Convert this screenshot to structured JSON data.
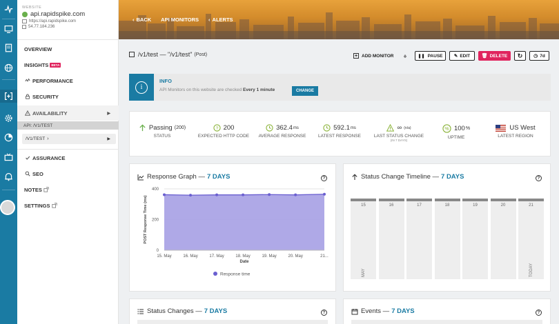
{
  "site": {
    "caption": "WEBSITE",
    "name": "api.rapidspike.com",
    "url": "https://api.rapidspike.com",
    "ip": "54.77.184.236"
  },
  "nav": {
    "overview": "OVERVIEW",
    "insights": "INSIGHTS",
    "beta": "BETA",
    "performance": "PERFORMANCE",
    "security": "SECURITY",
    "availability": "AVAILABILITY",
    "api_header": "API: /V1/TEST",
    "api_item": "/V1/TEST",
    "assurance": "ASSURANCE",
    "seo": "SEO",
    "notes": "NOTES",
    "settings": "SETTINGS"
  },
  "topnav": {
    "back": "BACK",
    "api_monitors": "API MONITORS",
    "alerts": "ALERTS"
  },
  "title": {
    "path": "/v1/test — \"/v1/test\"",
    "method": "(Post)"
  },
  "toolbar": {
    "add_monitor": "ADD MONITOR",
    "pause": "PAUSE",
    "edit": "EDIT",
    "delete": "DELETE",
    "range": "7d"
  },
  "info": {
    "title": "INFO",
    "text": "API Monitors on this website are checked",
    "interval": "Every 1 minute",
    "change": "CHANGE"
  },
  "stats": {
    "status_value": "Passing",
    "status_count": "(200)",
    "status_label": "STATUS",
    "http_value": "200",
    "http_label": "EXPECTED HTTP CODE",
    "avg_value": "362.4",
    "avg_unit": "ms",
    "avg_label": "AVERAGE RESPONSE",
    "latest_value": "592.1",
    "latest_unit": "ms",
    "latest_label": "LATEST RESPONSE",
    "change_value": "∞",
    "change_note": "(n/a)",
    "change_label": "LAST STATUS CHANGE",
    "change_sub": "(IN 7 DAYS)",
    "uptime_value": "100",
    "uptime_unit": "%",
    "uptime_label": "UPTIME",
    "region_value": "US West",
    "region_label": "LATEST REGION"
  },
  "response_card": {
    "title": "Response Graph —",
    "range": "7 DAYS",
    "help": "?"
  },
  "timeline_card": {
    "title": "Status Change Timeline —",
    "range": "7 DAYS",
    "help": "?",
    "days": [
      "15",
      "16",
      "17",
      "18",
      "19",
      "20",
      "21"
    ],
    "first_label": "MAY",
    "last_label": "TODAY"
  },
  "status_changes_card": {
    "title": "Status Changes —",
    "range": "7 DAYS",
    "help": "?"
  },
  "events_card": {
    "title": "Events —",
    "range": "7 DAYS",
    "help": "?"
  },
  "chart_data": {
    "type": "area",
    "x": [
      "15. May",
      "16. May",
      "17. May",
      "18. May",
      "19. May",
      "20. May",
      "21. May"
    ],
    "categories": [
      "15. May",
      "16. May",
      "17. May",
      "18. May",
      "19. May",
      "20. May",
      "21..."
    ],
    "series": [
      {
        "name": "Response time",
        "x": [
          15,
          16,
          17,
          18,
          19,
          20,
          21.1
        ],
        "values": [
          362,
          359,
          361,
          361,
          363,
          361,
          365
        ]
      }
    ],
    "xlabel": "Date",
    "ylabel": "POST Response Time (ms)",
    "yticks": [
      0,
      200,
      400
    ],
    "ylim": [
      0,
      400
    ],
    "color": "#a6a0e4",
    "line_color": "#6a5fd0"
  }
}
